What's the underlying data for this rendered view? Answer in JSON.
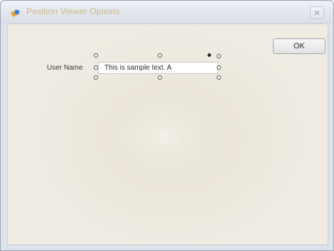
{
  "window": {
    "title": "Position Viewer Options",
    "close_icon": "close-icon"
  },
  "dialog": {
    "ok_label": "OK"
  },
  "designer": {
    "label_text": "User Name",
    "sample_text": "This is sample text.  A"
  },
  "colors": {
    "title_text": "#c9b58a",
    "client_background": "#efeae1",
    "handle_border": "#4a4a4a"
  }
}
